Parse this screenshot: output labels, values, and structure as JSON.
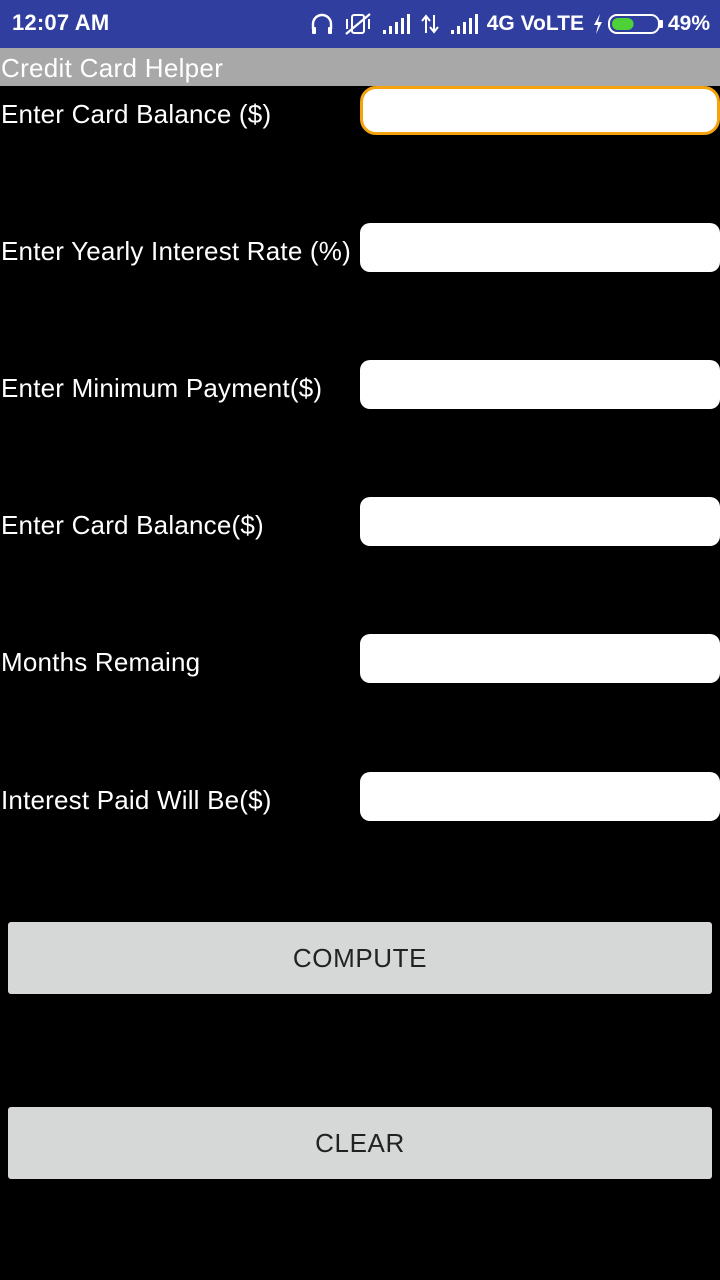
{
  "status_bar": {
    "time": "12:07 AM",
    "network": "4G VoLTE",
    "battery": "49%",
    "battery_level": 0.49,
    "icons": [
      "headphones-icon",
      "vibrate-off-icon",
      "signal-icon",
      "data-transfer-icon",
      "signal-icon",
      "charging-icon",
      "battery-icon"
    ]
  },
  "app": {
    "title": "Credit Card Helper"
  },
  "form": {
    "rows": [
      {
        "label": "Enter Card Balance ($)",
        "value": "",
        "focused": true
      },
      {
        "label": "Enter Yearly Interest Rate (%)",
        "value": ""
      },
      {
        "label": "Enter Minimum Payment($)",
        "value": ""
      },
      {
        "label": "Enter Card Balance($)",
        "value": ""
      },
      {
        "label": "Months Remaing",
        "value": ""
      },
      {
        "label": "Interest Paid Will Be($)",
        "value": ""
      }
    ]
  },
  "buttons": {
    "compute": "COMPUTE",
    "clear": "CLEAR"
  },
  "colors": {
    "status_bar": "#303F9F",
    "title_bar": "#A8A8A8",
    "background": "#000000",
    "focus_border": "#F5A20F",
    "button_bg": "#D6D7D7",
    "battery_fill": "#4CD137"
  }
}
